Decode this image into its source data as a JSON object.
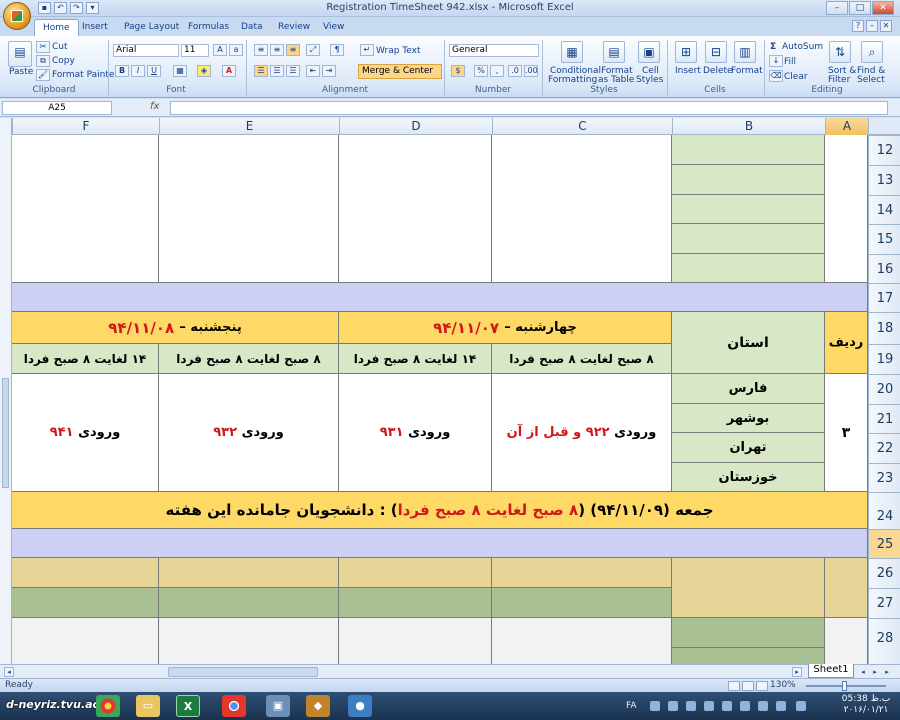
{
  "window": {
    "title": "Registration TimeSheet 942.xlsx - Microsoft Excel",
    "controls": [
      "–",
      "□",
      "✕"
    ]
  },
  "ribbon_tabs": [
    "Home",
    "Insert",
    "Page Layout",
    "Formulas",
    "Data",
    "Review",
    "View"
  ],
  "ribbon": {
    "clipboard": {
      "paste": "Paste",
      "cut": "Cut",
      "copy": "Copy",
      "format_painter": "Format Painter",
      "label": "Clipboard"
    },
    "font": {
      "name": "Arial",
      "size": "11",
      "bold": "B",
      "italic": "I",
      "underline": "U",
      "label": "Font"
    },
    "alignment": {
      "wrap_text": "Wrap Text",
      "merge_center": "Merge & Center",
      "label": "Alignment"
    },
    "number": {
      "format": "General",
      "percent": "%",
      "comma": ",",
      "label": "Number"
    },
    "styles": {
      "conditional_formatting_1": "Conditional",
      "conditional_formatting_2": "Formatting",
      "format_as_table_1": "Format",
      "format_as_table_2": "as Table",
      "cell_styles_1": "Cell",
      "cell_styles_2": "Styles",
      "label": "Styles"
    },
    "cells": {
      "insert": "Insert",
      "delete": "Delete",
      "format": "Format",
      "label": "Cells"
    },
    "editing": {
      "autosum": "AutoSum",
      "fill": "Fill",
      "clear": "Clear",
      "sort_filter_1": "Sort &",
      "sort_filter_2": "Filter",
      "find_select_1": "Find &",
      "find_select_2": "Select",
      "label": "Editing"
    }
  },
  "formula_bar": {
    "name_box": "A25",
    "fx": "fx"
  },
  "columns": [
    "F",
    "E",
    "D",
    "C",
    "B",
    "A"
  ],
  "rows": [
    "12",
    "13",
    "14",
    "15",
    "16",
    "17",
    "18",
    "19",
    "20",
    "21",
    "22",
    "23",
    "24",
    "25",
    "26",
    "27",
    "28"
  ],
  "sheet": {
    "header_radif": "ردیف",
    "header_ostan": "استان",
    "wed_day": "چهارشنبه –",
    "wed_date": "۹۴/۱۱/۰۷",
    "thu_day": "پنجشنبه –",
    "thu_date": "۹۴/۱۱/۰۸",
    "slot_morning": "۸ صبح لغایت ۸ صبح فردا",
    "slot_14": "۱۴ لغایت ۸ صبح فردا",
    "row_number": "۳",
    "provinces": [
      "فارس",
      "بوشهر",
      "تهران",
      "خوزستان"
    ],
    "entries": {
      "c_label": "ورودی",
      "c_value": "۹۲۲",
      "c_suffix": "و قبل از آن",
      "d_label": "ورودی",
      "d_value": "۹۳۱",
      "e_label": "ورودی",
      "e_value": "۹۳۲",
      "f_label": "ورودی",
      "f_value": "۹۴۱"
    },
    "friday_part1": "جمعه (۹۴/۱۱/۰۹) (",
    "friday_red": "۸ صبح لغایت ۸ صبح فردا",
    "friday_part2": ") : دانشجویان جامانده این هفته"
  },
  "sheet_tab": "Sheet1",
  "status": {
    "ready": "Ready",
    "zoom": "130%"
  },
  "taskbar": {
    "watermark": "d-neyriz.tvu.ac.ir",
    "lang": "FA",
    "time": "05:38 ب.ظ",
    "date": "۲۰۱۶/۰۱/۲۱"
  }
}
